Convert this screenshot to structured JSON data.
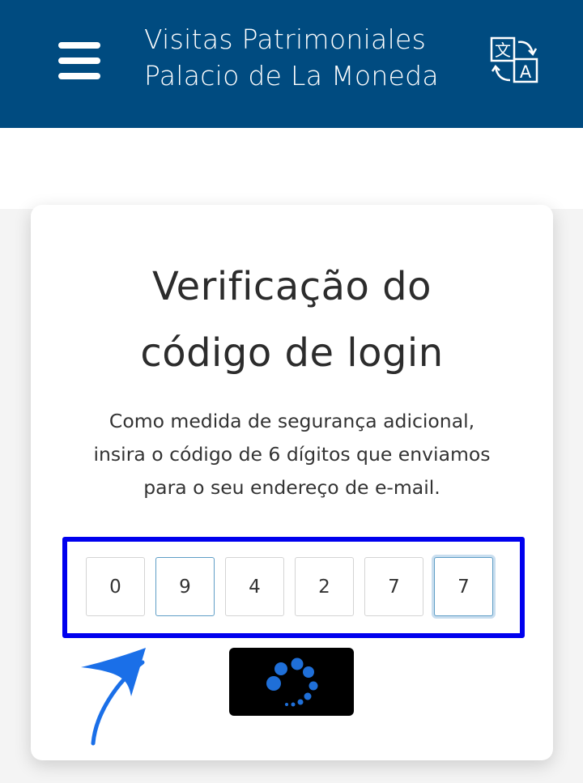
{
  "header": {
    "title_line1": "Visitas Patrimoniales",
    "title_line2": "Palacio de La Moneda",
    "menu_icon": "hamburger-menu-icon",
    "translate_icon": "translate-icon",
    "translate_glyph_a": "文",
    "translate_glyph_b": "A",
    "bg_color": "#004b80"
  },
  "card": {
    "title_line1": "Verificação do",
    "title_line2": "código de login",
    "description_line1": "Como medida de segurança adicional,",
    "description_line2": "insira o código de 6 dígitos que enviamos",
    "description_line3": "para o seu endereço de e-mail."
  },
  "code": {
    "digits": [
      "0",
      "9",
      "4",
      "2",
      "7",
      "7"
    ],
    "frame_color": "#0000ee"
  },
  "annotation": {
    "arrow_icon": "pointer-arrow-icon",
    "arrow_color": "#1a6fe8"
  },
  "loader": {
    "icon": "loading-spinner-icon",
    "dot_color": "#1f6fd8"
  }
}
